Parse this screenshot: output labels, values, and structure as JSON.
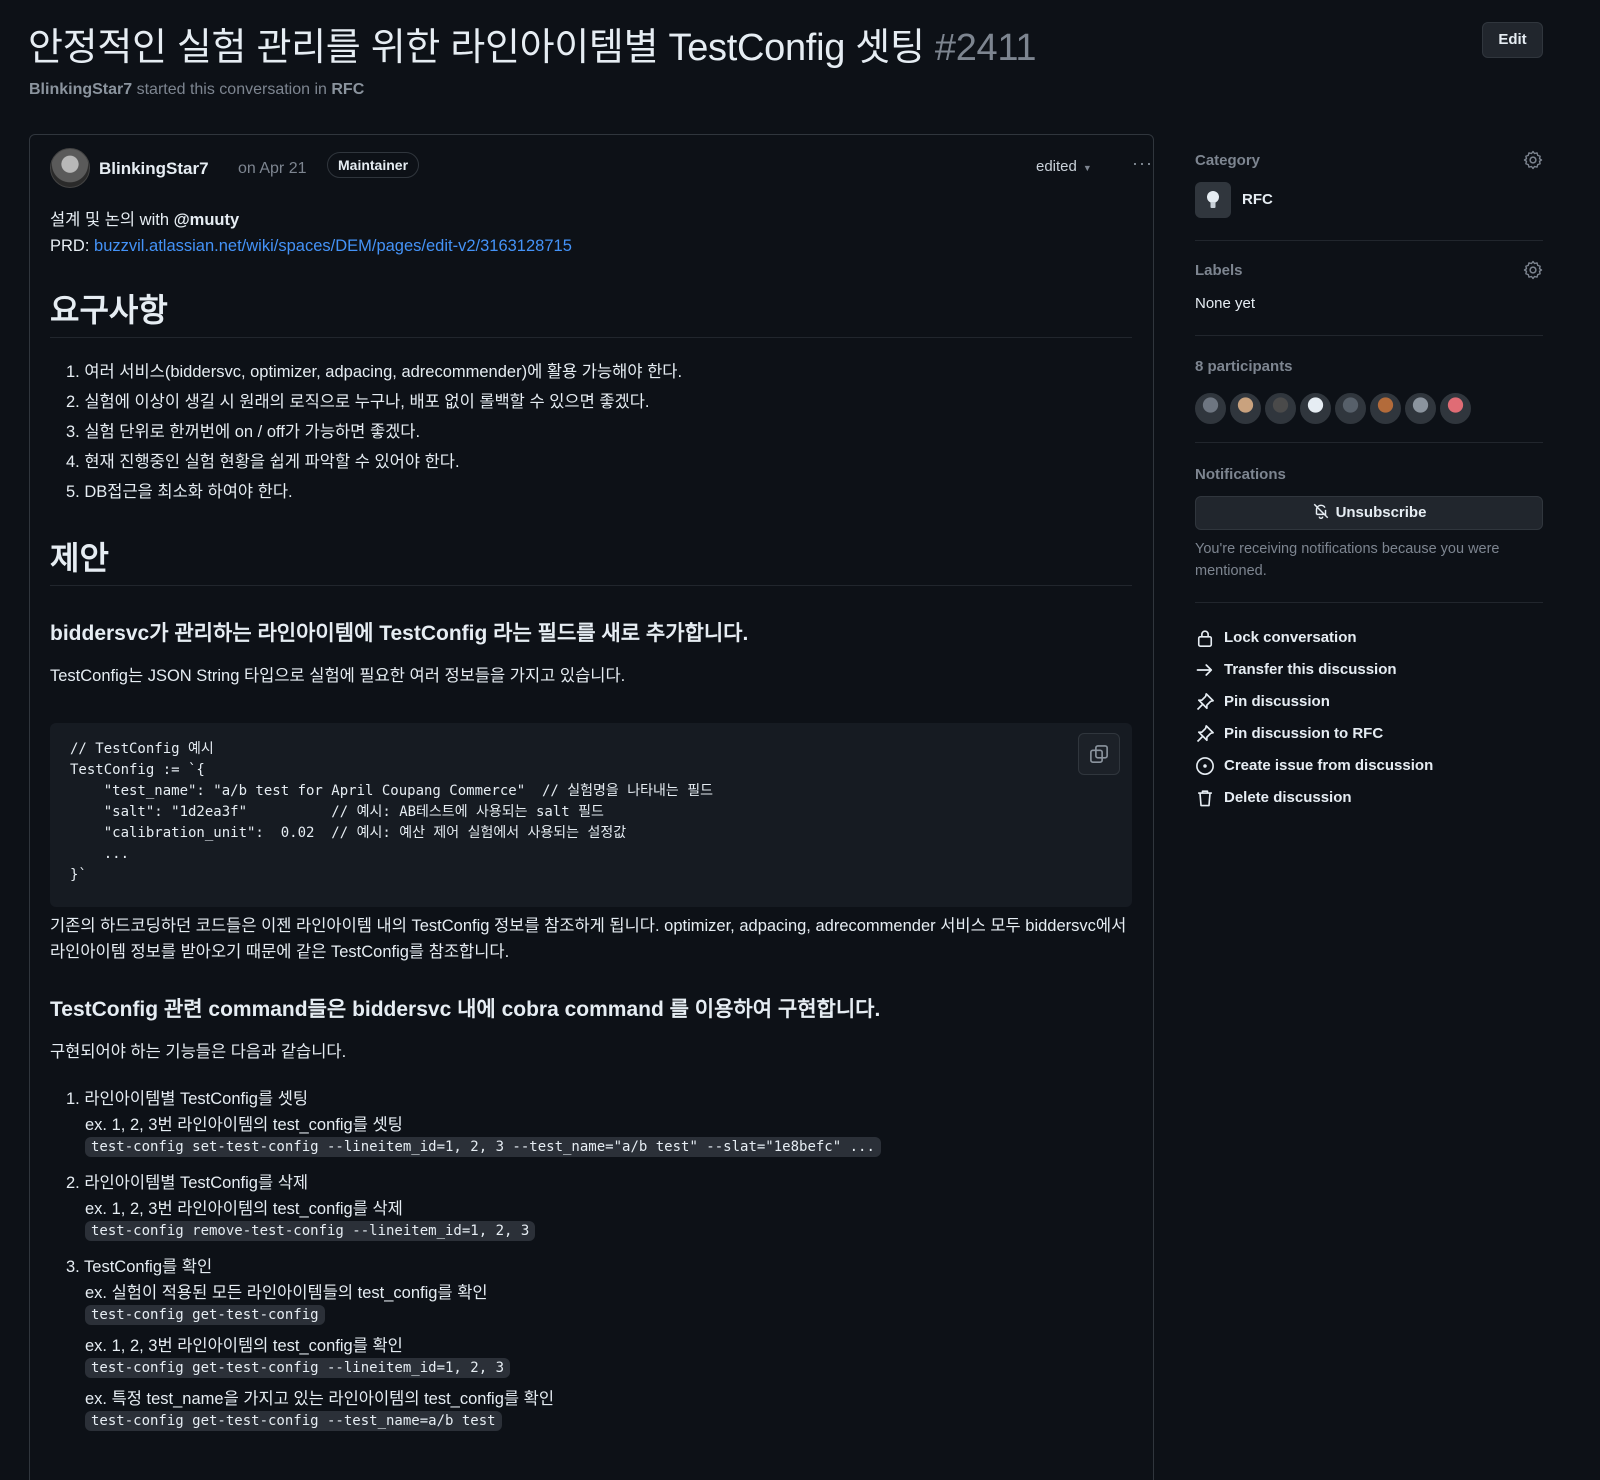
{
  "header": {
    "title": "안정적인 실험 관리를 위한 라인아이템별 TestConfig 셋팅",
    "number": "#2411",
    "author": "BlinkingStar7",
    "started_text": "started this conversation in",
    "category": "RFC",
    "edit_label": "Edit"
  },
  "post": {
    "author": "BlinkingStar7",
    "date": "on Apr 21",
    "role": "Maintainer",
    "edited_label": "edited",
    "intro_prefix": "설계 및 논의 with ",
    "intro_mention": "@muuty",
    "prd_label": "PRD: ",
    "prd_link": "buzzvil.atlassian.net/wiki/spaces/DEM/pages/edit-v2/3163128715",
    "requirements_heading": "요구사항",
    "requirements": [
      "1. 여러 서비스(biddersvc, optimizer, adpacing, adrecommender)에 활용 가능해야 한다.",
      "2. 실험에 이상이 생길 시 원래의 로직으로 누구나, 배포 없이 롤백할 수 있으면 좋겠다.",
      "3. 실험 단위로 한꺼번에 on / off가 가능하면 좋겠다.",
      "4. 현재 진행중인 실험 현황을 쉽게 파악할 수 있어야 한다.",
      "5. DB접근을 최소화 하여야 한다."
    ],
    "proposal_heading": "제안",
    "sub1": "biddersvc가 관리하는 라인아이템에 TestConfig 라는 필드를 새로 추가합니다.",
    "sub1_desc": "TestConfig는 JSON String 타입으로 실험에 필요한 여러 정보들을 가지고 있습니다.",
    "code_lines": [
      "// TestConfig 예시",
      "TestConfig := `{",
      "    \"test_name\": \"a/b test for April Coupang Commerce\"  // 실험명을 나타내는 필드",
      "    \"salt\": \"1d2ea3f\"          // 예시: AB테스트에 사용되는 salt 필드",
      "    \"calibration_unit\":  0.02  // 예시: 예산 제어 실험에서 사용되는 설정값",
      "    ...",
      "}`"
    ],
    "para_after_code": "기존의 하드코딩하던 코드들은 이젠 라인아이템 내의 TestConfig 정보를 참조하게 됩니다. optimizer, adpacing, adrecommender 서비스 모두 biddersvc에서 라인아이템 정보를 받아오기 때문에 같은 TestConfig를 참조합니다.",
    "sub2": "TestConfig 관련 command들은 biddersvc 내에 cobra command 를 이용하여 구현합니다.",
    "sub2_desc": "구현되어야 하는 기능들은 다음과 같습니다.",
    "functions": [
      {
        "title": "1. 라인아이템별 TestConfig를 셋팅",
        "items": [
          {
            "ex": "ex. 1, 2, 3번 라인아이템의 test_config를 셋팅",
            "cmd": "test-config set-test-config --lineitem_id=1, 2, 3 --test_name=\"a/b test\" --slat=\"1e8befc\" ..."
          }
        ]
      },
      {
        "title": "2. 라인아이템별 TestConfig를 삭제",
        "items": [
          {
            "ex": "ex. 1, 2, 3번 라인아이템의 test_config를 삭제",
            "cmd": "test-config remove-test-config --lineitem_id=1, 2, 3"
          }
        ]
      },
      {
        "title": "3. TestConfig를 확인",
        "items": [
          {
            "ex": "ex. 실험이 적용된 모든 라인아이템들의 test_config를 확인",
            "cmd": "test-config get-test-config"
          },
          {
            "ex": "ex. 1, 2, 3번 라인아이템의 test_config를 확인",
            "cmd": "test-config get-test-config --lineitem_id=1, 2, 3"
          },
          {
            "ex": "ex. 특정 test_name을 가지고 있는 라인아이템의 test_config를 확인",
            "cmd": "test-config get-test-config --test_name=a/b test"
          }
        ]
      }
    ]
  },
  "sidebar": {
    "category_label": "Category",
    "category_value": "RFC",
    "labels_label": "Labels",
    "labels_value": "None yet",
    "participants_label": "8 participants",
    "participant_colors": [
      "#6e7681",
      "#c9a27e",
      "#4a4a4a",
      "#e6edf3",
      "#57606a",
      "#b36b3a",
      "#8b949e",
      "#e06c75"
    ],
    "notifications_label": "Notifications",
    "unsubscribe_label": "Unsubscribe",
    "notifications_note": "You're receiving notifications because you were mentioned.",
    "actions": [
      {
        "icon": "lock-icon",
        "label": "Lock conversation"
      },
      {
        "icon": "arrow-right-icon",
        "label": "Transfer this discussion"
      },
      {
        "icon": "pin-icon",
        "label": "Pin discussion"
      },
      {
        "icon": "pin-icon",
        "label": "Pin discussion to RFC"
      },
      {
        "icon": "issue-opened-icon",
        "label": "Create issue from discussion"
      },
      {
        "icon": "trash-icon",
        "label": "Delete discussion"
      }
    ]
  },
  "colors": {
    "background": "#0d1117",
    "link": "#4493f8",
    "muted": "#7d8590",
    "border": "#30363d"
  }
}
